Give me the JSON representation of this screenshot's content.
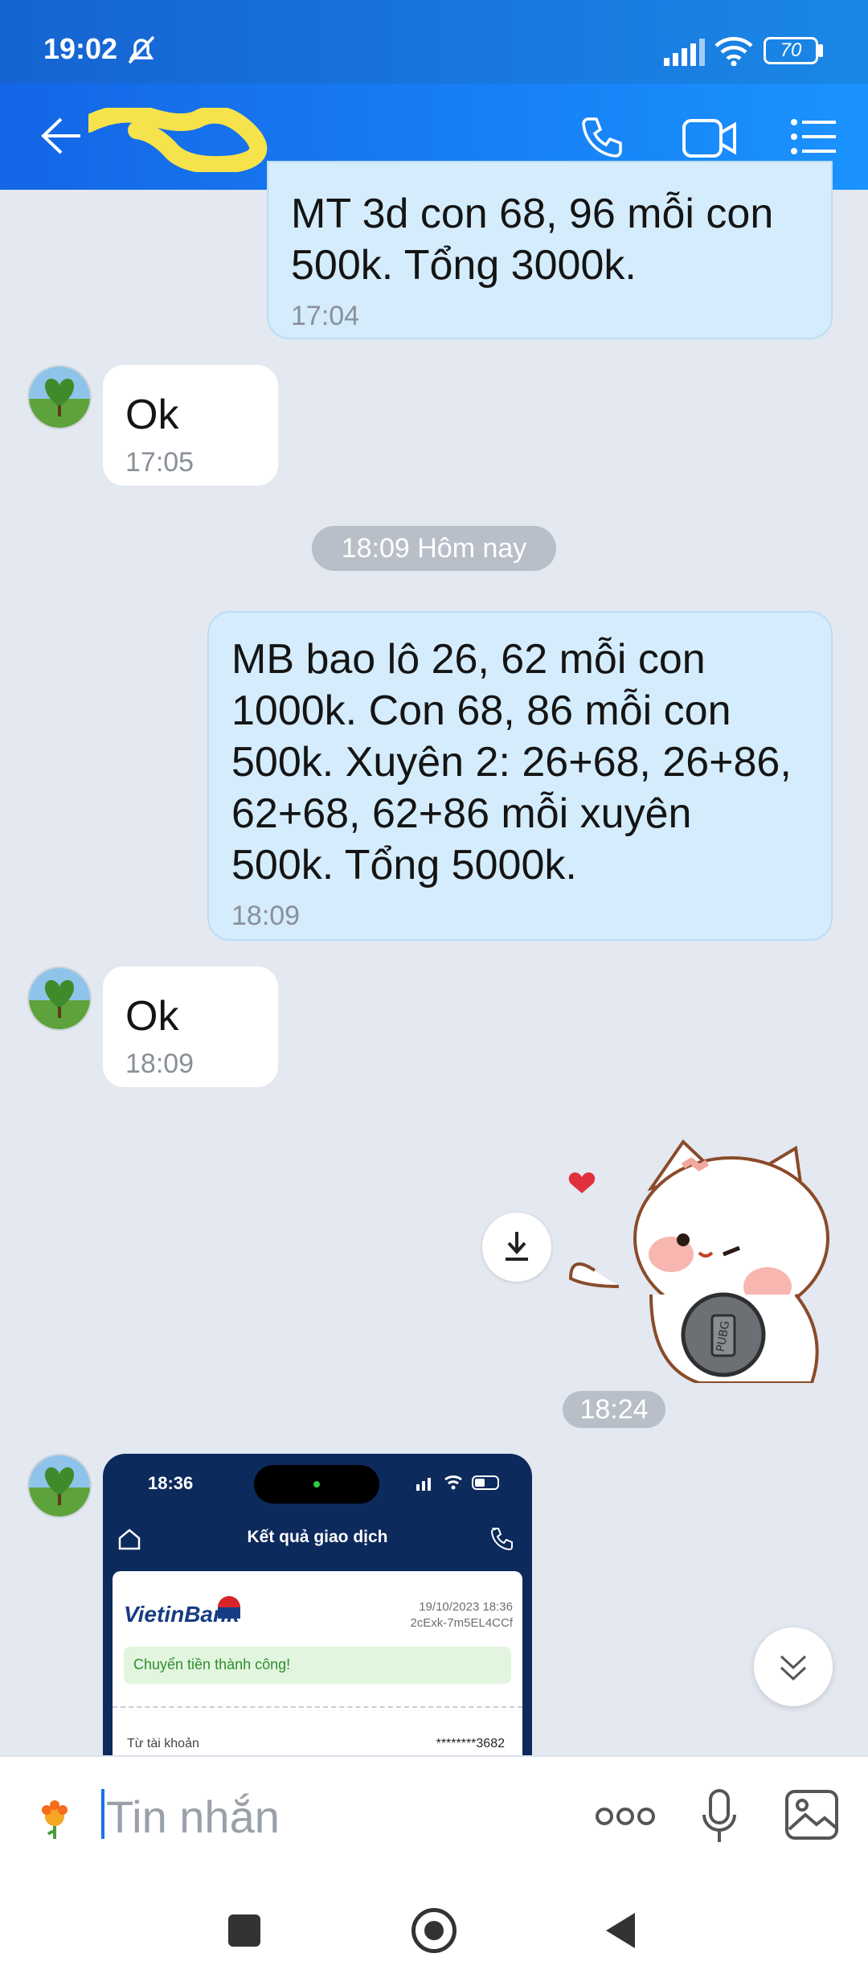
{
  "status_bar": {
    "time": "19:02",
    "battery": "70"
  },
  "header": {
    "contact_name": ""
  },
  "messages": [
    {
      "id": "m1",
      "direction": "out",
      "text": "MT 3d con 68, 96 mỗi con\n500k. Tổng 3000k.",
      "time": "17:04"
    },
    {
      "id": "m2",
      "direction": "in",
      "text": "Ok",
      "time": "17:05"
    },
    {
      "id": "m3",
      "direction": "out",
      "text": "MB bao lô 26, 62 mỗi con\n1000k. Con 68, 86 mỗi con\n500k. Xuyên 2: 26+68, 26+86,\n62+68, 62+86 mỗi xuyên\n500k. Tổng 5000k.",
      "time": "18:09"
    },
    {
      "id": "m4",
      "direction": "in",
      "text": "Ok",
      "time": "18:09"
    },
    {
      "id": "m5",
      "direction": "out",
      "type": "sticker",
      "time": "18:24"
    }
  ],
  "date_separator": "18:09 Hôm nay",
  "sticker_text": "PUBG",
  "screenshot": {
    "time": "18:36",
    "title": "Kết quả giao dịch",
    "bank": "VietinBank",
    "datetime": "19/10/2023 18:36",
    "ref": "2cExk-7m5EL4CCf",
    "status": "Chuyển tiền thành công!",
    "from_label": "Từ tài khoản",
    "account": "********3682"
  },
  "input": {
    "placeholder": "Tin nhắn"
  },
  "colors": {
    "header": "#1a87e6",
    "outgoing_bubble": "#d4ecfc",
    "incoming_bubble": "#ffffff",
    "background": "#e3e8f1"
  }
}
